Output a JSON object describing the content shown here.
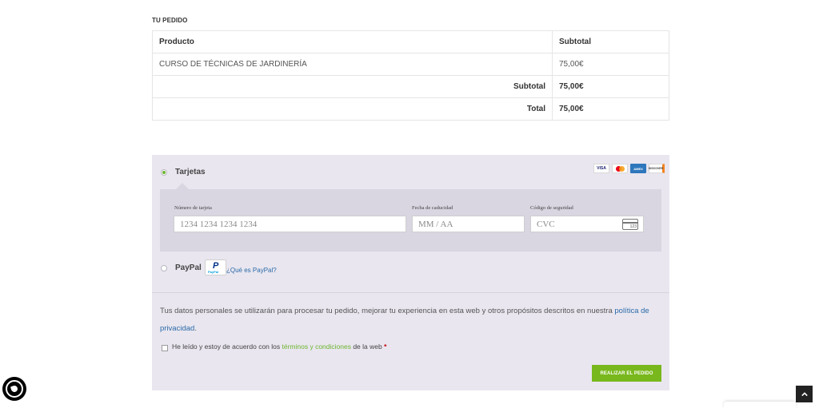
{
  "order": {
    "section_title": "TU PEDIDO",
    "headers": {
      "product": "Producto",
      "subtotal": "Subtotal"
    },
    "rows": [
      {
        "product": "CURSO DE TÉCNICAS DE JARDINERÍA",
        "amount": "75,00€"
      }
    ],
    "subtotal_label": "Subtotal",
    "subtotal_value": "75,00€",
    "total_label": "Total",
    "total_value": "75,00€"
  },
  "payment": {
    "card_method_label": "Tarjetas",
    "card_brands": [
      "VISA",
      "mastercard",
      "AMEX",
      "DISCOVER"
    ],
    "card_number": {
      "label": "Número de tarjeta",
      "placeholder": "1234 1234 1234 1234"
    },
    "expiry": {
      "label": "Fecha de caducidad",
      "placeholder": "MM / AA"
    },
    "cvc": {
      "label": "Código de seguridad",
      "placeholder": "CVC",
      "icon_text": "123"
    },
    "paypal_label": "PayPal",
    "paypal_logo_text": "PayPal",
    "paypal_link": "¿Qué es PayPal?"
  },
  "privacy": {
    "text": "Tus datos personales se utilizarán para procesar tu pedido, mejorar tu experiencia en esta web y otros propósitos descritos en nuestra ",
    "link": "política de privacidad",
    "end": "."
  },
  "terms": {
    "prefix": "He leído y estoy de acuerdo con los ",
    "link": "términos y condiciones",
    "suffix": " de la web ",
    "required": "*"
  },
  "submit_label": "REALIZAR EL PEDIDO",
  "colors": {
    "accent_green": "#79b81d",
    "panel_bg": "#e9e6ef",
    "link_blue": "#2b6aa8"
  },
  "icons": {
    "whatsapp": "whatsapp-icon",
    "scroll_top": "chevron-up-icon",
    "cvc": "credit-card-icon"
  }
}
